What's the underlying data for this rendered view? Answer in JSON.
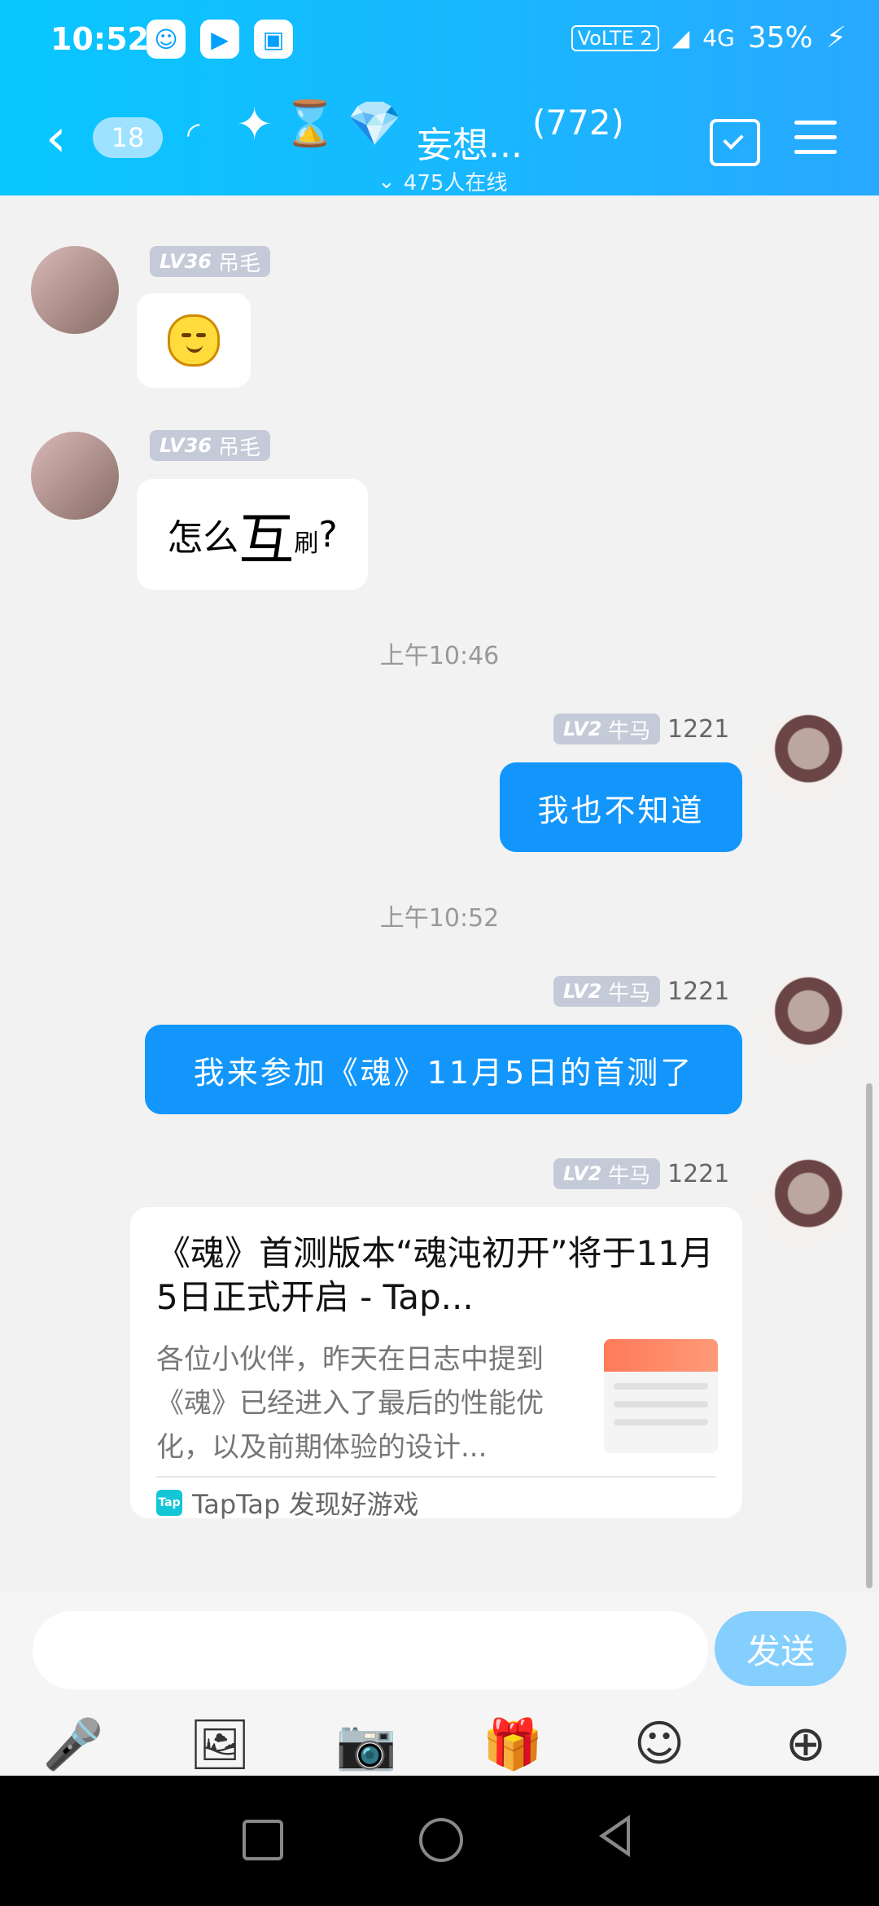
{
  "status_bar": {
    "time": "10:52",
    "battery": "35%",
    "network": "4G",
    "volte": "VoLTE 2"
  },
  "header": {
    "back_badge": "18",
    "title": "妄想...",
    "member_count": "(772)",
    "online_text": "475人在线",
    "accent_color": "#08c7ff"
  },
  "messages": [
    {
      "level": "LV36",
      "name": "吊毛",
      "type": "emoji"
    },
    {
      "level": "LV36",
      "name": "吊毛",
      "text_before": "怎么",
      "text_big": "互",
      "text_small": "刷",
      "text_after": "?"
    },
    {
      "timestamp": "上午10:46"
    },
    {
      "level": "LV2",
      "name": "牛马",
      "uid": "1221",
      "text": "我也不知道"
    },
    {
      "timestamp": "上午10:52"
    },
    {
      "level": "LV2",
      "name": "牛马",
      "uid": "1221",
      "text": "我来参加《魂》11月5日的首测了"
    },
    {
      "level": "LV2",
      "name": "牛马",
      "uid": "1221",
      "card": {
        "title": "《魂》首测版本“魂沌初开”将于11月5日正式开启 - Tap...",
        "description": "各位小伙伴，昨天在日志中提到《魂》已经进入了最后的性能优化，以及前期体验的设计...",
        "source": "TapTap 发现好游戏",
        "source_icon": "Tap"
      }
    }
  ],
  "input": {
    "placeholder": "",
    "send_label": "发送"
  },
  "toolbar_icons": [
    "microphone-icon",
    "image-icon",
    "camera-icon",
    "gift-icon",
    "emoji-icon",
    "plus-icon"
  ]
}
